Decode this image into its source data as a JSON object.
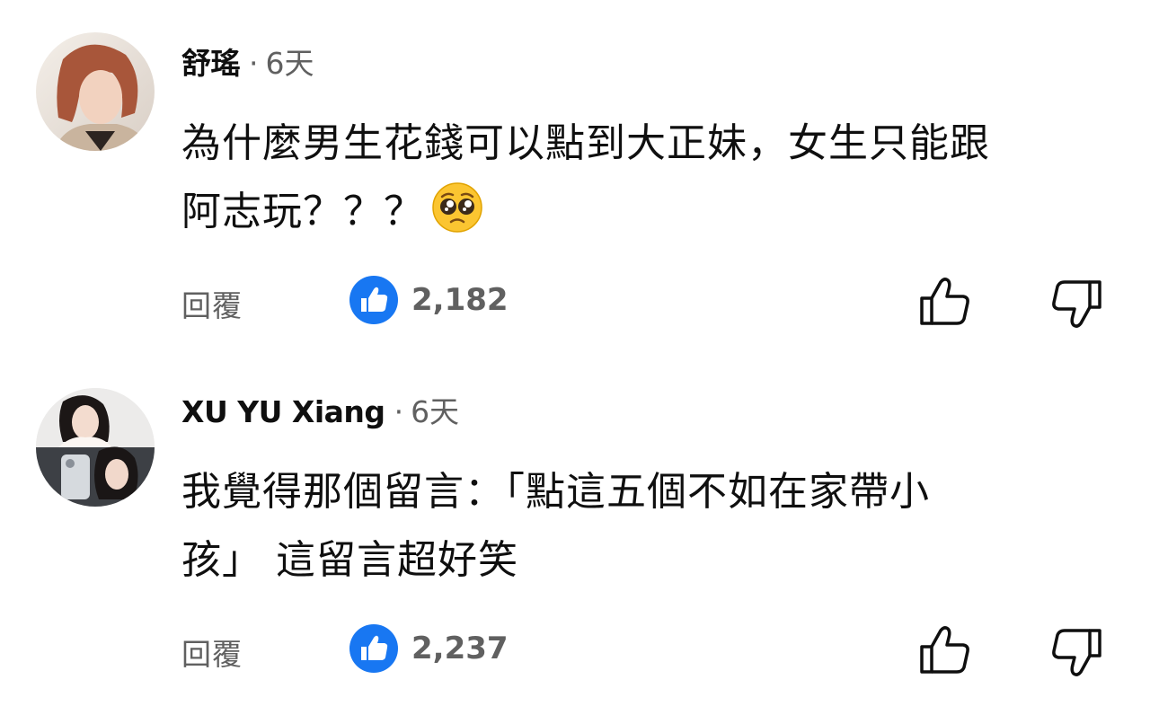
{
  "comments": [
    {
      "author": "舒瑤",
      "separator": "·",
      "time": "6天",
      "text_line1": "為什麼男生花錢可以點到大正妹，女生只能跟",
      "text_line2": "阿志玩？？？",
      "reply_label": "回覆",
      "like_count": "2,182",
      "avatar_icon": "avatar-photo-woman",
      "emoji": "pleading-face-emoji"
    },
    {
      "author": "XU YU Xiang",
      "separator": "·",
      "time": "6天",
      "text_line1": "我覺得那個留言：「點這五個不如在家帶小",
      "text_line2": "孩」 這留言超好笑",
      "reply_label": "回覆",
      "like_count": "2,237",
      "avatar_icon": "avatar-photo-collage"
    }
  ],
  "colors": {
    "like_badge": "#1877f2",
    "meta_text": "#606060",
    "main_text": "#0f0f0f"
  }
}
